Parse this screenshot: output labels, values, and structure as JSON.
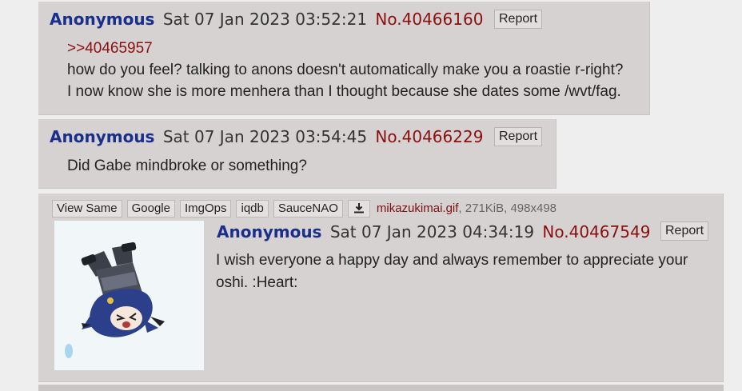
{
  "posts": [
    {
      "name": "Anonymous",
      "date": "Sat 07 Jan 2023 03:52:21",
      "number": "No.40466160",
      "report_label": "Report",
      "quote_link": ">>40465957",
      "lines": [
        "how do you feel? talking to anons doesn't automatically make you a roastie r-right?",
        "I now know she is more menhera than I thought because she dates some /wvt/fag."
      ]
    },
    {
      "name": "Anonymous",
      "date": "Sat 07 Jan 2023 03:54:45",
      "number": "No.40466229",
      "report_label": "Report",
      "lines": [
        "Did Gabe mindbroke or something?"
      ]
    },
    {
      "name": "Anonymous",
      "date": "Sat 07 Jan 2023 04:34:19",
      "number": "No.40467549",
      "report_label": "Report",
      "lines": [
        "I wish everyone a happy day and always remember to appreciate your oshi. :Heart:"
      ],
      "file": {
        "tools": [
          "View Same",
          "Google",
          "ImgOps",
          "iqdb",
          "SauceNAO"
        ],
        "download_icon": "download-icon",
        "filename": "mikazukimai.gif",
        "meta": ", 271KiB, 498x498",
        "thumbnail": "anime-girl-falling-thumbnail"
      }
    }
  ]
}
